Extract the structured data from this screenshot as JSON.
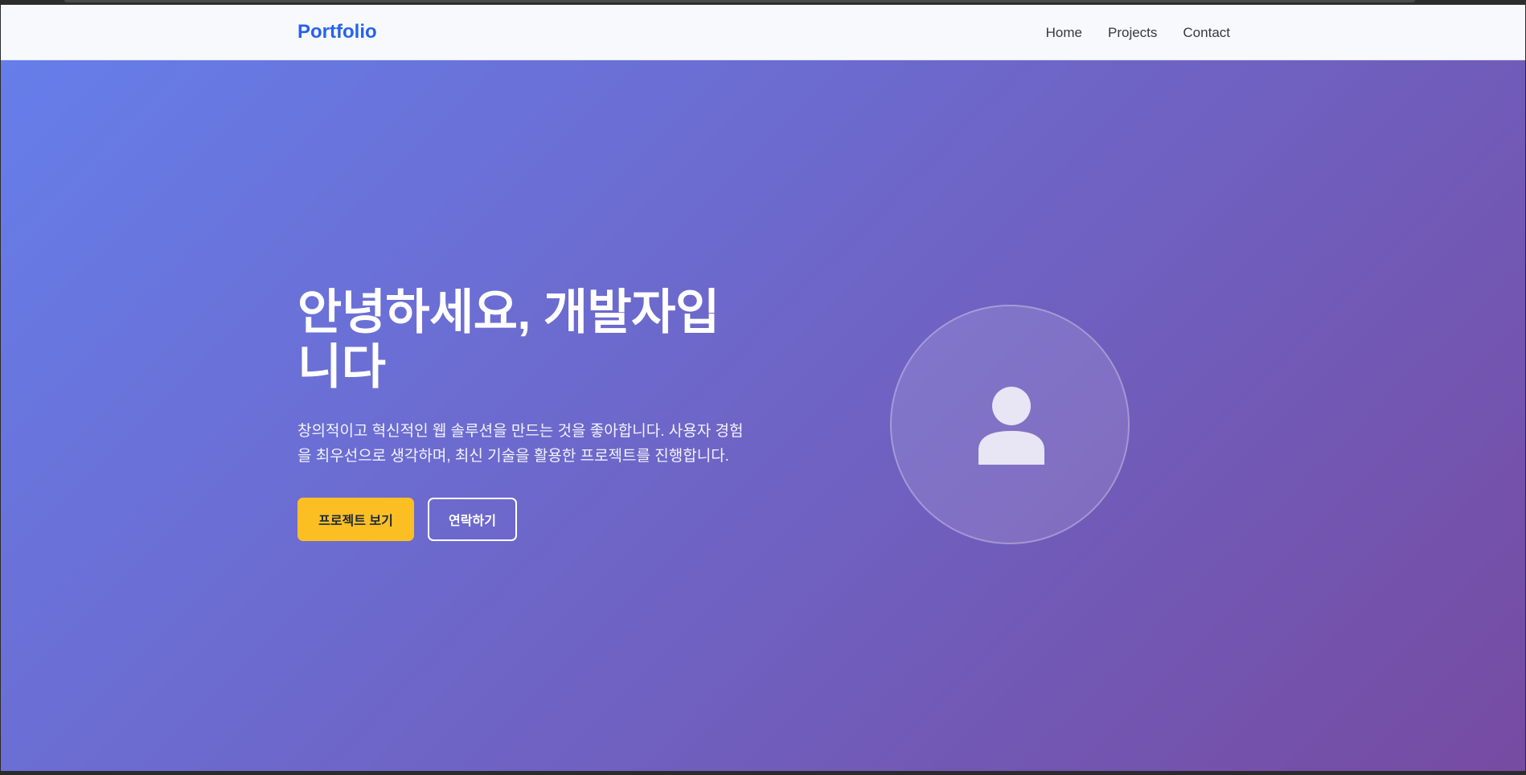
{
  "navbar": {
    "brand": "Portfolio",
    "links": [
      {
        "label": "Home"
      },
      {
        "label": "Projects"
      },
      {
        "label": "Contact"
      }
    ]
  },
  "hero": {
    "title": "안녕하세요, 개발자입니다",
    "description": "창의적이고 혁신적인 웹 솔루션을 만드는 것을 좋아합니다. 사용자 경험을 최우선으로 생각하며, 최신 기술을 활용한 프로젝트를 진행합니다.",
    "primary_button": "프로젝트 보기",
    "secondary_button": "연락하기",
    "avatar_icon": "user-icon"
  },
  "colors": {
    "brand": "#2563eb",
    "gradient_start": "#667eea",
    "gradient_end": "#764ba2",
    "primary_button": "#fbbf24"
  }
}
